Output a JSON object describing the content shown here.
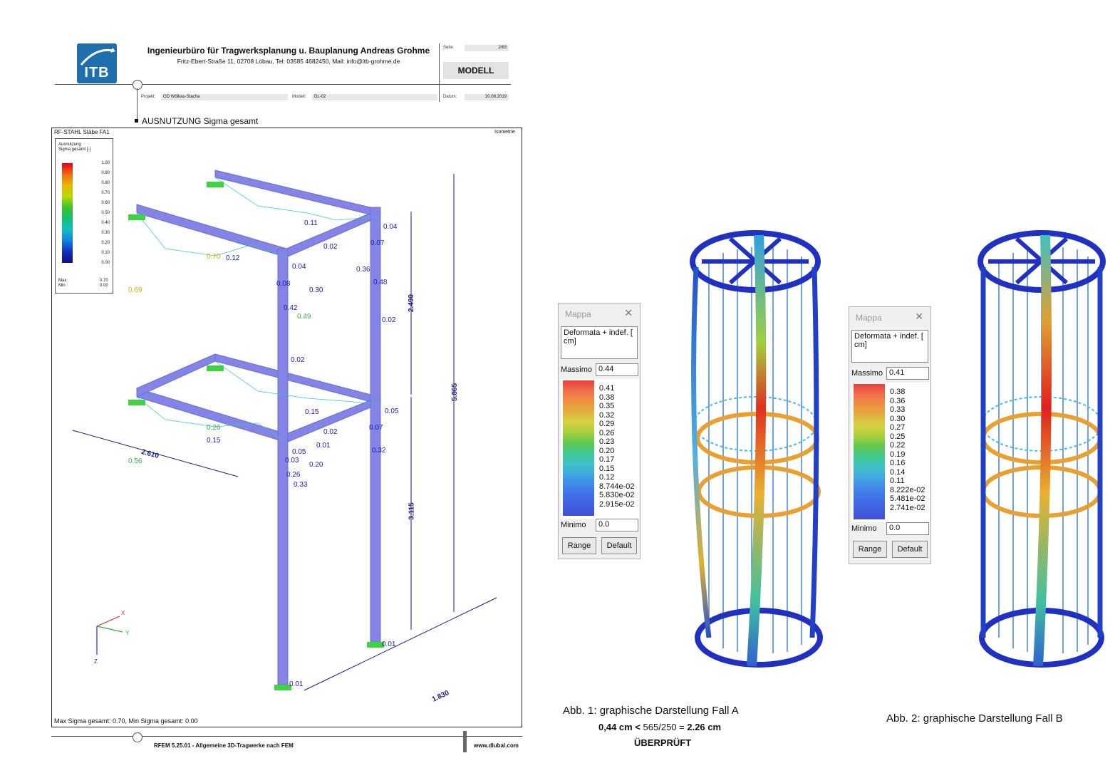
{
  "sheet": {
    "logo_text": "ITB",
    "firm_name": "Ingenieurbüro für Tragwerksplanung u. Bauplanung Andreas Grohme",
    "firm_address": "Fritz-Ebert-Straße 11,  02708 Löbau, Tel: 03585 4682450, Mail: info@itb-grohme.de",
    "seite_label": "Seite:",
    "seite_value": "2/63",
    "modell_label": "MODELL",
    "projekt_label": "Projekt:",
    "projekt_value": "OD Wölkau-Stacha",
    "modell_field_label": "Modell:",
    "modell_field_value": "DL-02",
    "datum_label": "Datum:",
    "datum_value": "20.08.2019",
    "section_title": "AUSNUTZUNG Sigma gesamt",
    "module_label": "RF-STAHL Stäbe FA1",
    "view_label": "Isometrie",
    "footer_summary": "Max Sigma gesamt: 0.70, Min Sigma gesamt: 0.00",
    "footer_software": "RFEM 5.25.01 - Allgemeine 3D-Tragwerke nach FEM",
    "footer_url": "www.dlubal.com",
    "legend": {
      "title1": "Ausnutzung",
      "title2": "Sigma gesamt [-]",
      "ticks": [
        "1.00",
        "0.90",
        "0.80",
        "0.70",
        "0.60",
        "0.50",
        "0.40",
        "0.30",
        "0.20",
        "0.10",
        "0.00"
      ],
      "max_label": "Max :",
      "max_value": "0.70",
      "min_label": "Min :",
      "min_value": "0.00"
    },
    "dimensions": [
      "2.490",
      "5.865",
      "3.115",
      "2.610",
      "1.830"
    ],
    "member_values": [
      "0.11",
      "0.04",
      "0.02",
      "0.07",
      "0.70",
      "0.12",
      "0.36",
      "0.69",
      "0.04",
      "0.08",
      "0.30",
      "0.48",
      "0.42",
      "0.49",
      "0.02",
      "0.02",
      "0.15",
      "0.05",
      "0.26",
      "0.02",
      "0.07",
      "0.15",
      "0.56",
      "0.05",
      "0.01",
      "0.32",
      "0.03",
      "0.20",
      "0.26",
      "0.33",
      "0.01",
      "0.01"
    ],
    "axes": {
      "x": "X",
      "y": "Y",
      "z": "Z"
    }
  },
  "mappa_a": {
    "title": "Mappa",
    "description": "Deformata + indef.  [ cm]",
    "massimo_label": "Massimo",
    "massimo_value": "0.44",
    "scale": [
      "0.41",
      "0.38",
      "0.35",
      "0.32",
      "0.29",
      "0.26",
      "0.23",
      "0.20",
      "0.17",
      "0.15",
      "0.12",
      "8.744e-02",
      "5.830e-02",
      "2.915e-02"
    ],
    "minimo_label": "Minimo",
    "minimo_value": "0.0",
    "range_label": "Range",
    "default_label": "Default"
  },
  "mappa_b": {
    "title": "Mappa",
    "description": "Deformata + indef.  [ cm]",
    "massimo_label": "Massimo",
    "massimo_value": "0.41",
    "scale": [
      "0.38",
      "0.36",
      "0.33",
      "0.30",
      "0.27",
      "0.25",
      "0.22",
      "0.19",
      "0.16",
      "0.14",
      "0.11",
      "8.222e-02",
      "5.481e-02",
      "2.741e-02"
    ],
    "minimo_label": "Minimo",
    "minimo_value": "0.0",
    "range_label": "Range",
    "default_label": "Default"
  },
  "captions": {
    "fig1": "Abb. 1: graphische Darstellung Fall A",
    "fig1_check_a": "0,44 cm <",
    "fig1_check_b": "565/250 =",
    "fig1_check_c": "2.26 cm",
    "fig1_status": "ÜBERPRÜFT",
    "fig2": "Abb. 2: graphische Darstellung Fall B"
  },
  "colors": {
    "structure": "#7b7bdf",
    "dimension": "#1a1a80",
    "brand": "#1f6fae"
  }
}
